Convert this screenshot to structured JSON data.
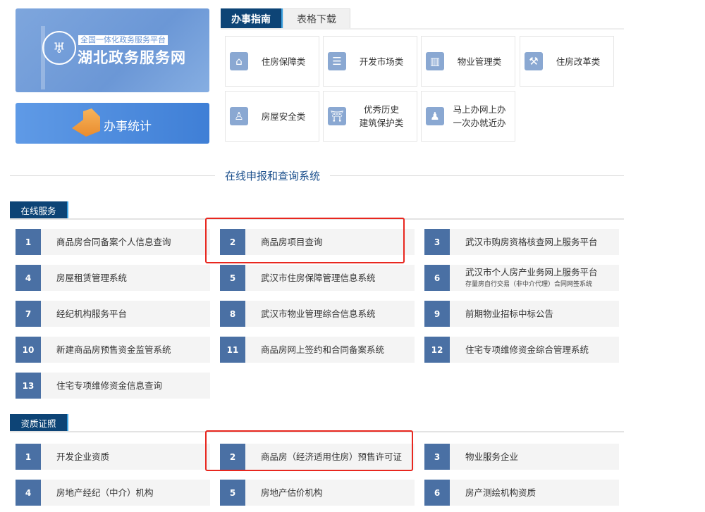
{
  "banner": {
    "subtitle": "全国一体化政务服务平台",
    "title": "湖北政务服务网"
  },
  "stats": {
    "label": "办事统计"
  },
  "tabs": [
    {
      "label": "办事指南"
    },
    {
      "label": "表格下载"
    }
  ],
  "guide": [
    {
      "label": "住房保障类",
      "icon": "house-icon"
    },
    {
      "label": "开发市场类",
      "icon": "document-person-icon"
    },
    {
      "label": "物业管理类",
      "icon": "building-icon"
    },
    {
      "label": "住房改革类",
      "icon": "house-wrench-icon"
    },
    {
      "label": "房屋安全类",
      "icon": "worker-icon"
    },
    {
      "label": "优秀历史建筑保护类",
      "line1": "优秀历史",
      "line2": "建筑保护类",
      "icon": "pavilion-icon"
    },
    {
      "label": "马上办网上办一次办就近办",
      "line1": "马上办网上办",
      "line2": "一次办就近办",
      "icon": "stamp-icon"
    }
  ],
  "section_title": "在线申报和查询系统",
  "online": {
    "header": "在线服务",
    "items": [
      {
        "n": "1",
        "label": "商品房合同备案个人信息查询"
      },
      {
        "n": "2",
        "label": "商品房项目查询"
      },
      {
        "n": "3",
        "label": "武汉市购房资格核查网上服务平台"
      },
      {
        "n": "4",
        "label": "房屋租赁管理系统"
      },
      {
        "n": "5",
        "label": "武汉市住房保障管理信息系统"
      },
      {
        "n": "6",
        "label": "武汉市个人房产业务网上服务平台",
        "sub": "存量房自行交易（非中介代理）合同网签系统"
      },
      {
        "n": "7",
        "label": "经纪机构服务平台"
      },
      {
        "n": "8",
        "label": "武汉市物业管理综合信息系统"
      },
      {
        "n": "9",
        "label": "前期物业招标中标公告"
      },
      {
        "n": "10",
        "label": "新建商品房预售资金监管系统"
      },
      {
        "n": "11",
        "label": "商品房网上签约和合同备案系统"
      },
      {
        "n": "12",
        "label": "住宅专项维修资金综合管理系统"
      },
      {
        "n": "13",
        "label": "住宅专项维修资金信息查询"
      }
    ]
  },
  "cert": {
    "header": "资质证照",
    "items": [
      {
        "n": "1",
        "label": "开发企业资质"
      },
      {
        "n": "2",
        "label": "商品房（经济适用住房）预售许可证"
      },
      {
        "n": "3",
        "label": "物业服务企业"
      },
      {
        "n": "4",
        "label": "房地产经纪（中介）机构"
      },
      {
        "n": "5",
        "label": "房地产估价机构"
      },
      {
        "n": "6",
        "label": "房产测绘机构资质"
      }
    ]
  }
}
